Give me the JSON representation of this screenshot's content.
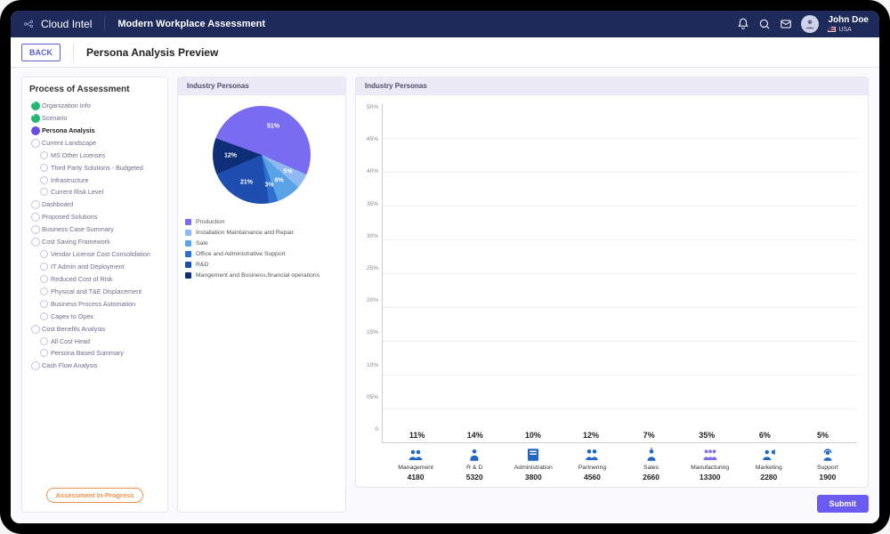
{
  "brand": {
    "name": "Cloud Intel"
  },
  "top": {
    "title": "Modern Workplace Assessment"
  },
  "user": {
    "name": "John Doe",
    "loc": "USA"
  },
  "subhead": {
    "back": "BACK",
    "title": "Persona Analysis Preview"
  },
  "side": {
    "title": "Process of Assessment",
    "status_badge": "Assessment In-Progress",
    "items": [
      {
        "label": "Organization Info",
        "state": "done",
        "level": 1
      },
      {
        "label": "Scenario",
        "state": "done",
        "level": 1
      },
      {
        "label": "Persona Analysis",
        "state": "current",
        "level": 1
      },
      {
        "label": "Current Landscape",
        "state": "pending",
        "level": 1
      },
      {
        "label": "MS Other Licenses",
        "state": "pending",
        "level": 2
      },
      {
        "label": "Third Party Solutions - Budgeted",
        "state": "pending",
        "level": 2
      },
      {
        "label": "Infrastructure",
        "state": "pending",
        "level": 2
      },
      {
        "label": "Current Risk Level",
        "state": "pending",
        "level": 2
      },
      {
        "label": "Dashboard",
        "state": "pending",
        "level": 1
      },
      {
        "label": "Proposed Solutions",
        "state": "pending",
        "level": 1
      },
      {
        "label": "Business Case Summary",
        "state": "pending",
        "level": 1
      },
      {
        "label": "Cost Saving Framework",
        "state": "pending",
        "level": 1
      },
      {
        "label": "Vendor License Cost Consolidation",
        "state": "pending",
        "level": 2
      },
      {
        "label": "IT Admin and Deployment",
        "state": "pending",
        "level": 2
      },
      {
        "label": "Reduced Cost of Risk",
        "state": "pending",
        "level": 2
      },
      {
        "label": "Physical and T&E Displacement",
        "state": "pending",
        "level": 2
      },
      {
        "label": "Business Process Automation",
        "state": "pending",
        "level": 2
      },
      {
        "label": "Capex to Opex",
        "state": "pending",
        "level": 2
      },
      {
        "label": "Cost Benefits Analysis",
        "state": "pending",
        "level": 1
      },
      {
        "label": "All Cost Head",
        "state": "pending",
        "level": 2
      },
      {
        "label": "Persona Based Summary",
        "state": "pending",
        "level": 2
      },
      {
        "label": "Cash Flow Analysis",
        "state": "pending",
        "level": 1
      }
    ]
  },
  "panels": {
    "pie_title": "Industry Personas",
    "bar_title": "Industry Personas"
  },
  "submit_label": "Submit",
  "chart_data": [
    {
      "type": "pie",
      "title": "Industry Personas",
      "series": [
        {
          "name": "Production",
          "value": 51,
          "color": "#7a6cf0"
        },
        {
          "name": "Installation Maintainance and Repair",
          "value": 5,
          "color": "#8fb9f2"
        },
        {
          "name": "Sale",
          "value": 8,
          "color": "#5aa2e6"
        },
        {
          "name": "Office and Administrative Support",
          "value": 3,
          "color": "#2f6fcf"
        },
        {
          "name": "R&D",
          "value": 21,
          "color": "#1e4fb0"
        },
        {
          "name": "Mangement and Business,financial operations",
          "value": 12,
          "color": "#0f2e78"
        }
      ]
    },
    {
      "type": "bar",
      "title": "Industry Personas",
      "ylabel": "",
      "ylim": [
        0,
        50
      ],
      "y_ticks": [
        "50%",
        "45%",
        "40%",
        "35%",
        "30%",
        "25%",
        "20%",
        "15%",
        "10%",
        "05%",
        "0"
      ],
      "categories": [
        "Management",
        "R & D",
        "Administration",
        "Partnering",
        "Sales",
        "Manufacturing",
        "Marketing",
        "Support"
      ],
      "values_pct": [
        11,
        14,
        10,
        12,
        7,
        35,
        6,
        5
      ],
      "values_count": [
        4180,
        5320,
        3800,
        4560,
        2660,
        13300,
        2280,
        1900
      ],
      "colors": [
        "#2e7de0",
        "#1f6fd6",
        "#2a87e2",
        "#2a87e2",
        "#4fa0ea",
        "#7a6cf0",
        "#59a7ee",
        "#6bb4f1"
      ]
    }
  ]
}
